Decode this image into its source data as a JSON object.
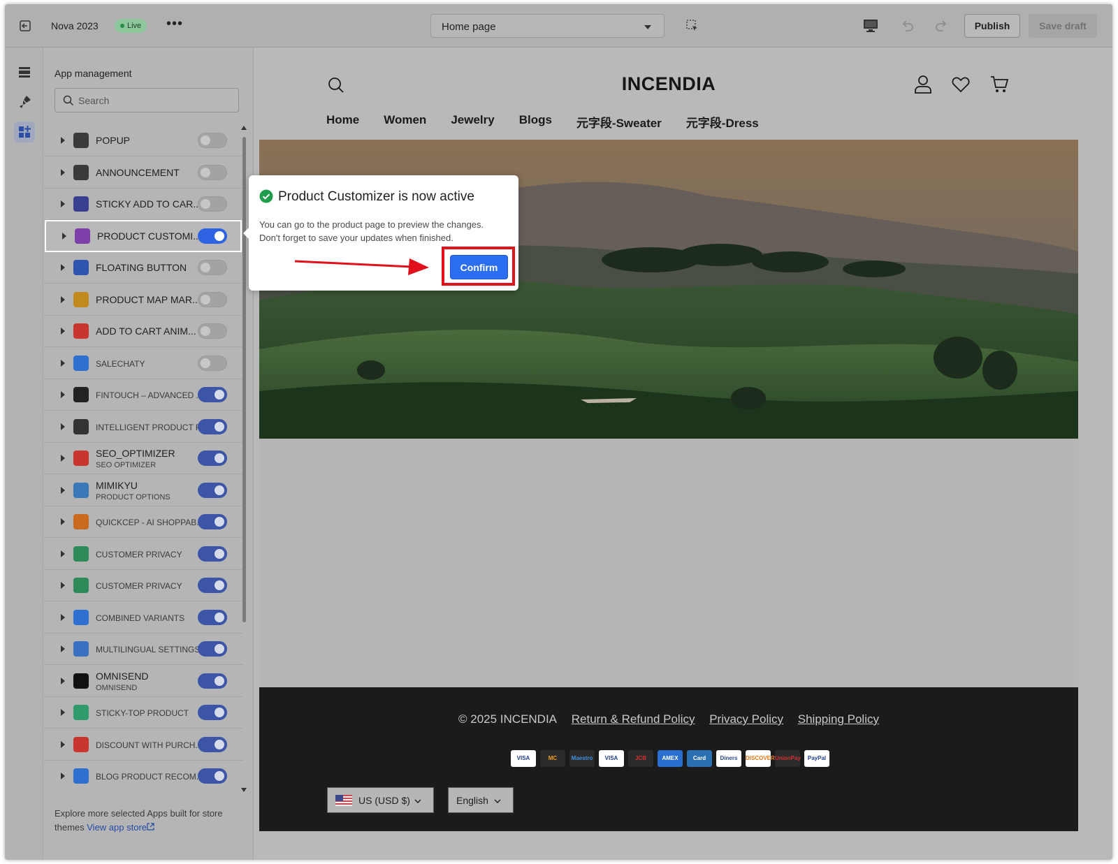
{
  "topbar": {
    "title": "Nova 2023",
    "status": "Live",
    "more": "•••",
    "page_select": "Home page",
    "publish": "Publish",
    "save_draft": "Save draft"
  },
  "panel": {
    "title": "App management",
    "search_placeholder": "Search",
    "footer_text": "Explore more selected Apps built for store themes ",
    "footer_link": "View app store"
  },
  "apps": [
    {
      "label": "POPUP",
      "enabled": false
    },
    {
      "label": "ANNOUNCEMENT",
      "enabled": false
    },
    {
      "label": "STICKY ADD TO CAR...",
      "enabled": false
    },
    {
      "label": "PRODUCT CUSTOMI...",
      "enabled": true
    },
    {
      "label": "FLOATING BUTTON",
      "enabled": false
    },
    {
      "label": "PRODUCT MAP MAR...",
      "enabled": false
    },
    {
      "label": "ADD TO CART ANIM...",
      "enabled": false
    },
    {
      "label": "SALECHATY",
      "enabled": false
    },
    {
      "label": "FINTOUCH – ADVANCED ...",
      "enabled": true
    },
    {
      "label": "INTELLIGENT PRODUCT R...",
      "enabled": true
    },
    {
      "label": "SEO_OPTIMIZER",
      "sub": "SEO OPTIMIZER",
      "enabled": true
    },
    {
      "label": "MIMIKYU",
      "sub": "PRODUCT OPTIONS",
      "enabled": true
    },
    {
      "label": "QUICKCEP - AI SHOPPAB...",
      "enabled": true
    },
    {
      "label": "CUSTOMER PRIVACY",
      "enabled": true
    },
    {
      "label": "CUSTOMER PRIVACY",
      "enabled": true
    },
    {
      "label": "COMBINED VARIANTS",
      "enabled": true
    },
    {
      "label": "MULTILINGUAL SETTINGS",
      "enabled": true
    },
    {
      "label": "OMNISEND",
      "sub": "OMNISEND",
      "enabled": true
    },
    {
      "label": "STICKY-TOP PRODUCT",
      "enabled": true
    },
    {
      "label": "DISCOUNT WITH PURCH...",
      "enabled": true
    },
    {
      "label": "BLOG PRODUCT RECOM...",
      "enabled": true
    }
  ],
  "store": {
    "logo": "INCENDIA",
    "nav": [
      "Home",
      "Women",
      "Jewelry",
      "Blogs",
      "元字段-Sweater",
      "元字段-Dress"
    ],
    "copyright": "© 2025 INCENDIA",
    "footer_links": [
      "Return & Refund Policy",
      "Privacy Policy",
      "Shipping Policy"
    ],
    "payments": [
      "VISA",
      "MC",
      "Maestro",
      "VISA",
      "JCB",
      "AMEX",
      "Card",
      "Diners",
      "DISCOVER",
      "UnionPay",
      "PayPal"
    ],
    "currency": "US  (USD $)",
    "language": "English"
  },
  "popover": {
    "title": "Product Customizer is now active",
    "body_line1": "You can go to the product page to preview the changes.",
    "body_line2": "Don't forget to save your updates when finished.",
    "confirm": "Confirm"
  },
  "colors": {
    "accent": "#2c6ef2",
    "highlight": "#e0111a",
    "live": "#2a8c43"
  }
}
